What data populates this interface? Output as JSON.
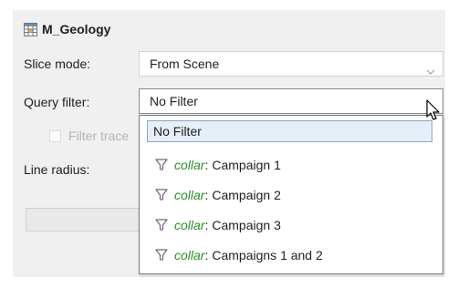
{
  "title": "M_Geology",
  "labels": {
    "slice_mode": "Slice mode:",
    "query_filter": "Query filter:",
    "filter_traces": "Filter trace",
    "line_radius": "Line radius:"
  },
  "slice_mode": {
    "value": "From Scene"
  },
  "query_filter": {
    "value": "No Filter"
  },
  "dropdown": {
    "selected": "No Filter",
    "items": [
      {
        "object": "collar",
        "sep": ":",
        "name": "Campaign 1"
      },
      {
        "object": "collar",
        "sep": ":",
        "name": "Campaign 2"
      },
      {
        "object": "collar",
        "sep": ":",
        "name": "Campaign 3"
      },
      {
        "object": "collar",
        "sep": ":",
        "name": "Campaigns 1 and 2"
      }
    ]
  },
  "colors": {
    "object_name": "#2a8f2a",
    "highlight_bg": "#e6eef7",
    "highlight_border": "#88a9c9"
  },
  "icons": {
    "title": "grid-table-icon",
    "chevron": "chevron-down-icon",
    "filter": "funnel-filter-icon",
    "cursor": "mouse-pointer-icon"
  }
}
